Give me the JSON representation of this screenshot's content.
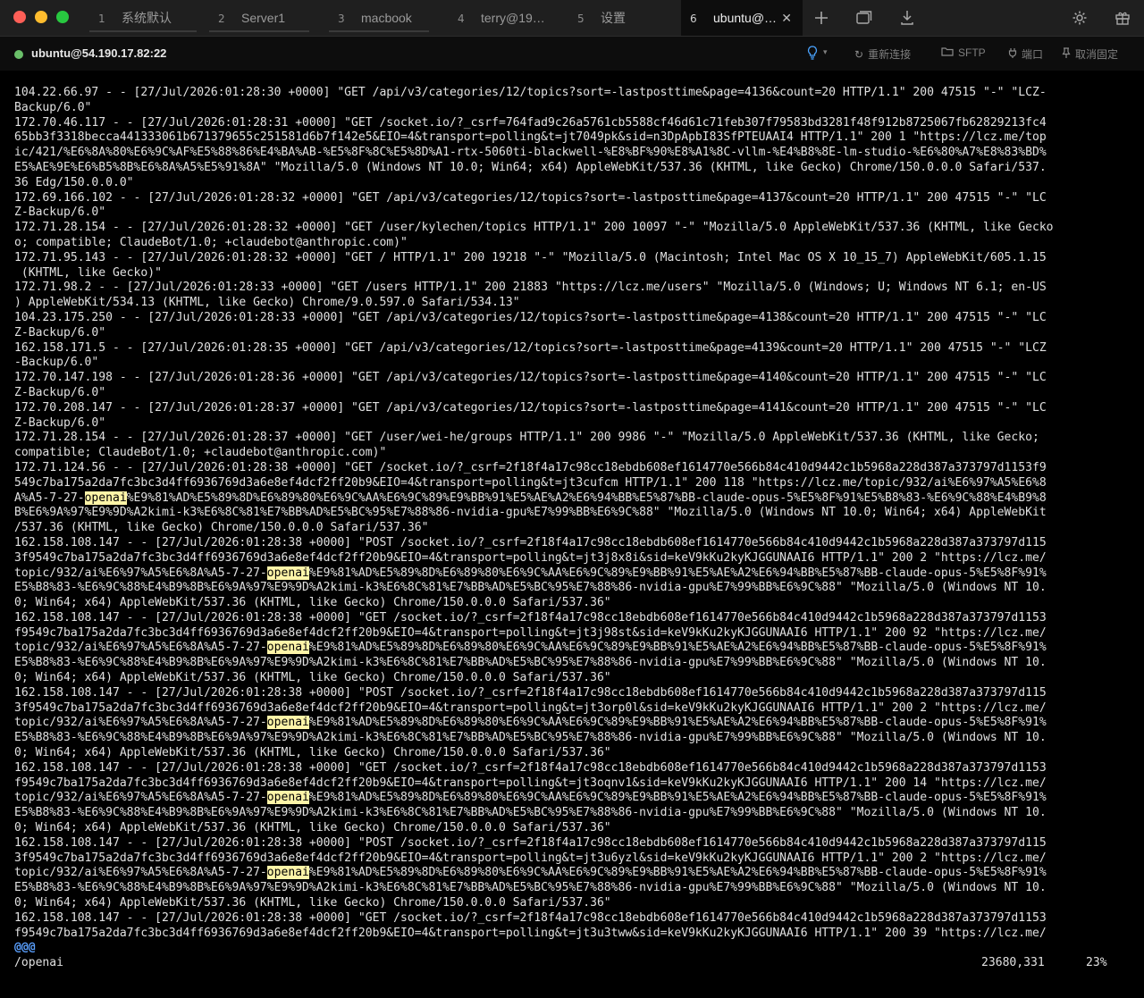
{
  "tabs": [
    {
      "num": "1",
      "label": "系统默认",
      "active": false
    },
    {
      "num": "2",
      "label": "Server1",
      "active": false
    },
    {
      "num": "3",
      "label": "macbook",
      "active": false
    },
    {
      "num": "4",
      "label": "terry@19…",
      "active": false
    },
    {
      "num": "5",
      "label": "设置",
      "active": false
    },
    {
      "num": "6",
      "label": "ubuntu@…",
      "active": true
    }
  ],
  "tab_close": "✕",
  "toolbar_icons": [
    "add-tab-icon",
    "split-window-icon",
    "download-icon",
    "gear-icon",
    "gift-icon"
  ],
  "connection": {
    "host": "ubuntu@54.190.17.82:22",
    "status_color": "#6abf69"
  },
  "actions": {
    "reconnect": "重新连接",
    "sftp": "SFTP",
    "port": "端口",
    "unpin": "取消固定"
  },
  "search_highlight": "openai",
  "terminal_lines": [
    "104.22.66.97 - - [27/Jul/2026:01:28:30 +0000] \"GET /api/v3/categories/12/topics?sort=-lastposttime&page=4136&count=20 HTTP/1.1\" 200 47515 \"-\" \"LCZ-",
    "Backup/6.0\"",
    "172.70.46.117 - - [27/Jul/2026:01:28:31 +0000] \"GET /socket.io/?_csrf=764fad9c26a5761cb5588cf46d61c71feb307f79583bd3281f48f912b8725067fb62829213fc4",
    "65bb3f3318becca441333061b671379655c251581d6b7f142e5&EIO=4&transport=polling&t=jt7049pk&sid=n3DpApbI83SfPTEUAAI4 HTTP/1.1\" 200 1 \"https://lcz.me/top",
    "ic/421/%E6%8A%80%E6%9C%AF%E5%88%86%E4%BA%AB-%E5%8F%8C%E5%8D%A1-rtx-5060ti-blackwell-%E8%BF%90%E8%A1%8C-vllm-%E4%B8%8E-lm-studio-%E6%80%A7%E8%83%BD%",
    "E5%AE%9E%E6%B5%8B%E6%8A%A5%E5%91%8A\" \"Mozilla/5.0 (Windows NT 10.0; Win64; x64) AppleWebKit/537.36 (KHTML, like Gecko) Chrome/150.0.0.0 Safari/537.",
    "36 Edg/150.0.0.0\"",
    "172.69.166.102 - - [27/Jul/2026:01:28:32 +0000] \"GET /api/v3/categories/12/topics?sort=-lastposttime&page=4137&count=20 HTTP/1.1\" 200 47515 \"-\" \"LC",
    "Z-Backup/6.0\"",
    "172.71.28.154 - - [27/Jul/2026:01:28:32 +0000] \"GET /user/kylechen/topics HTTP/1.1\" 200 10097 \"-\" \"Mozilla/5.0 AppleWebKit/537.36 (KHTML, like Gecko",
    "o; compatible; ClaudeBot/1.0; +claudebot@anthropic.com)\"",
    "172.71.95.143 - - [27/Jul/2026:01:28:32 +0000] \"GET / HTTP/1.1\" 200 19218 \"-\" \"Mozilla/5.0 (Macintosh; Intel Mac OS X 10_15_7) AppleWebKit/605.1.15",
    " (KHTML, like Gecko)\"",
    "172.71.98.2 - - [27/Jul/2026:01:28:33 +0000] \"GET /users HTTP/1.1\" 200 21883 \"https://lcz.me/users\" \"Mozilla/5.0 (Windows; U; Windows NT 6.1; en-US",
    ") AppleWebKit/534.13 (KHTML, like Gecko) Chrome/9.0.597.0 Safari/534.13\"",
    "104.23.175.250 - - [27/Jul/2026:01:28:33 +0000] \"GET /api/v3/categories/12/topics?sort=-lastposttime&page=4138&count=20 HTTP/1.1\" 200 47515 \"-\" \"LC",
    "Z-Backup/6.0\"",
    "162.158.171.5 - - [27/Jul/2026:01:28:35 +0000] \"GET /api/v3/categories/12/topics?sort=-lastposttime&page=4139&count=20 HTTP/1.1\" 200 47515 \"-\" \"LCZ",
    "-Backup/6.0\"",
    "172.70.147.198 - - [27/Jul/2026:01:28:36 +0000] \"GET /api/v3/categories/12/topics?sort=-lastposttime&page=4140&count=20 HTTP/1.1\" 200 47515 \"-\" \"LC",
    "Z-Backup/6.0\"",
    "172.70.208.147 - - [27/Jul/2026:01:28:37 +0000] \"GET /api/v3/categories/12/topics?sort=-lastposttime&page=4141&count=20 HTTP/1.1\" 200 47515 \"-\" \"LC",
    "Z-Backup/6.0\"",
    "172.71.28.154 - - [27/Jul/2026:01:28:37 +0000] \"GET /user/wei-he/groups HTTP/1.1\" 200 9986 \"-\" \"Mozilla/5.0 AppleWebKit/537.36 (KHTML, like Gecko;",
    "compatible; ClaudeBot/1.0; +claudebot@anthropic.com)\"",
    "172.71.124.56 - - [27/Jul/2026:01:28:38 +0000] \"GET /socket.io/?_csrf=2f18f4a17c98cc18ebdb608ef1614770e566b84c410d9442c1b5968a228d387a373797d1153f9",
    "549c7ba175a2da7fc3bc3d4ff6936769d3a6e8ef4dcf2ff20b9&EIO=4&transport=polling&t=jt3cufcm HTTP/1.1\" 200 118 \"https://lcz.me/topic/932/ai%E6%97%A5%E6%8",
    "A%A5-7-27-openai%E9%81%AD%E5%89%8D%E6%89%80%E6%9C%AA%E6%9C%89%E9%BB%91%E5%AE%A2%E6%94%BB%E5%87%BB-claude-opus-5%E5%8F%91%E5%B8%83-%E6%9C%88%E4%B9%8",
    "B%E6%9A%97%E9%9D%A2kimi-k3%E6%8C%81%E7%BB%AD%E5%BC%95%E7%88%86-nvidia-gpu%E7%99%BB%E6%9C%88\" \"Mozilla/5.0 (Windows NT 10.0; Win64; x64) AppleWebKit",
    "/537.36 (KHTML, like Gecko) Chrome/150.0.0.0 Safari/537.36\"",
    "162.158.108.147 - - [27/Jul/2026:01:28:38 +0000] \"POST /socket.io/?_csrf=2f18f4a17c98cc18ebdb608ef1614770e566b84c410d9442c1b5968a228d387a373797d115",
    "3f9549c7ba175a2da7fc3bc3d4ff6936769d3a6e8ef4dcf2ff20b9&EIO=4&transport=polling&t=jt3j8x8i&sid=keV9kKu2kyKJGGUNAAI6 HTTP/1.1\" 200 2 \"https://lcz.me/",
    "topic/932/ai%E6%97%A5%E6%8A%A5-7-27-openai%E9%81%AD%E5%89%8D%E6%89%80%E6%9C%AA%E6%9C%89%E9%BB%91%E5%AE%A2%E6%94%BB%E5%87%BB-claude-opus-5%E5%8F%91%",
    "E5%B8%83-%E6%9C%88%E4%B9%8B%E6%9A%97%E9%9D%A2kimi-k3%E6%8C%81%E7%BB%AD%E5%BC%95%E7%88%86-nvidia-gpu%E7%99%BB%E6%9C%88\" \"Mozilla/5.0 (Windows NT 10.",
    "0; Win64; x64) AppleWebKit/537.36 (KHTML, like Gecko) Chrome/150.0.0.0 Safari/537.36\"",
    "162.158.108.147 - - [27/Jul/2026:01:28:38 +0000] \"GET /socket.io/?_csrf=2f18f4a17c98cc18ebdb608ef1614770e566b84c410d9442c1b5968a228d387a373797d1153",
    "f9549c7ba175a2da7fc3bc3d4ff6936769d3a6e8ef4dcf2ff20b9&EIO=4&transport=polling&t=jt3j98st&sid=keV9kKu2kyKJGGUNAAI6 HTTP/1.1\" 200 92 \"https://lcz.me/",
    "topic/932/ai%E6%97%A5%E6%8A%A5-7-27-openai%E9%81%AD%E5%89%8D%E6%89%80%E6%9C%AA%E6%9C%89%E9%BB%91%E5%AE%A2%E6%94%BB%E5%87%BB-claude-opus-5%E5%8F%91%",
    "E5%B8%83-%E6%9C%88%E4%B9%8B%E6%9A%97%E9%9D%A2kimi-k3%E6%8C%81%E7%BB%AD%E5%BC%95%E7%88%86-nvidia-gpu%E7%99%BB%E6%9C%88\" \"Mozilla/5.0 (Windows NT 10.",
    "0; Win64; x64) AppleWebKit/537.36 (KHTML, like Gecko) Chrome/150.0.0.0 Safari/537.36\"",
    "162.158.108.147 - - [27/Jul/2026:01:28:38 +0000] \"POST /socket.io/?_csrf=2f18f4a17c98cc18ebdb608ef1614770e566b84c410d9442c1b5968a228d387a373797d115",
    "3f9549c7ba175a2da7fc3bc3d4ff6936769d3a6e8ef4dcf2ff20b9&EIO=4&transport=polling&t=jt3orp0l&sid=keV9kKu2kyKJGGUNAAI6 HTTP/1.1\" 200 2 \"https://lcz.me/",
    "topic/932/ai%E6%97%A5%E6%8A%A5-7-27-openai%E9%81%AD%E5%89%8D%E6%89%80%E6%9C%AA%E6%9C%89%E9%BB%91%E5%AE%A2%E6%94%BB%E5%87%BB-claude-opus-5%E5%8F%91%",
    "E5%B8%83-%E6%9C%88%E4%B9%8B%E6%9A%97%E9%9D%A2kimi-k3%E6%8C%81%E7%BB%AD%E5%BC%95%E7%88%86-nvidia-gpu%E7%99%BB%E6%9C%88\" \"Mozilla/5.0 (Windows NT 10.",
    "0; Win64; x64) AppleWebKit/537.36 (KHTML, like Gecko) Chrome/150.0.0.0 Safari/537.36\"",
    "162.158.108.147 - - [27/Jul/2026:01:28:38 +0000] \"GET /socket.io/?_csrf=2f18f4a17c98cc18ebdb608ef1614770e566b84c410d9442c1b5968a228d387a373797d1153",
    "f9549c7ba175a2da7fc3bc3d4ff6936769d3a6e8ef4dcf2ff20b9&EIO=4&transport=polling&t=jt3oqnv1&sid=keV9kKu2kyKJGGUNAAI6 HTTP/1.1\" 200 14 \"https://lcz.me/",
    "topic/932/ai%E6%97%A5%E6%8A%A5-7-27-openai%E9%81%AD%E5%89%8D%E6%89%80%E6%9C%AA%E6%9C%89%E9%BB%91%E5%AE%A2%E6%94%BB%E5%87%BB-claude-opus-5%E5%8F%91%",
    "E5%B8%83-%E6%9C%88%E4%B9%8B%E6%9A%97%E9%9D%A2kimi-k3%E6%8C%81%E7%BB%AD%E5%BC%95%E7%88%86-nvidia-gpu%E7%99%BB%E6%9C%88\" \"Mozilla/5.0 (Windows NT 10.",
    "0; Win64; x64) AppleWebKit/537.36 (KHTML, like Gecko) Chrome/150.0.0.0 Safari/537.36\"",
    "162.158.108.147 - - [27/Jul/2026:01:28:38 +0000] \"POST /socket.io/?_csrf=2f18f4a17c98cc18ebdb608ef1614770e566b84c410d9442c1b5968a228d387a373797d115",
    "3f9549c7ba175a2da7fc3bc3d4ff6936769d3a6e8ef4dcf2ff20b9&EIO=4&transport=polling&t=jt3u6yzl&sid=keV9kKu2kyKJGGUNAAI6 HTTP/1.1\" 200 2 \"https://lcz.me/",
    "topic/932/ai%E6%97%A5%E6%8A%A5-7-27-openai%E9%81%AD%E5%89%8D%E6%89%80%E6%9C%AA%E6%9C%89%E9%BB%91%E5%AE%A2%E6%94%BB%E5%87%BB-claude-opus-5%E5%8F%91%",
    "E5%B8%83-%E6%9C%88%E4%B9%8B%E6%9A%97%E9%9D%A2kimi-k3%E6%8C%81%E7%BB%AD%E5%BC%95%E7%88%86-nvidia-gpu%E7%99%BB%E6%9C%88\" \"Mozilla/5.0 (Windows NT 10.",
    "0; Win64; x64) AppleWebKit/537.36 (KHTML, like Gecko) Chrome/150.0.0.0 Safari/537.36\"",
    "162.158.108.147 - - [27/Jul/2026:01:28:38 +0000] \"GET /socket.io/?_csrf=2f18f4a17c98cc18ebdb608ef1614770e566b84c410d9442c1b5968a228d387a373797d1153",
    "f9549c7ba175a2da7fc3bc3d4ff6936769d3a6e8ef4dcf2ff20b9&EIO=4&transport=polling&t=jt3u3tww&sid=keV9kKu2kyKJGGUNAAI6 HTTP/1.1\" 200 39 \"https://lcz.me/"
  ],
  "pager_marker": "@@@",
  "command_line": "/openai",
  "position_ruler": "23680,331",
  "position_percent": "23%"
}
